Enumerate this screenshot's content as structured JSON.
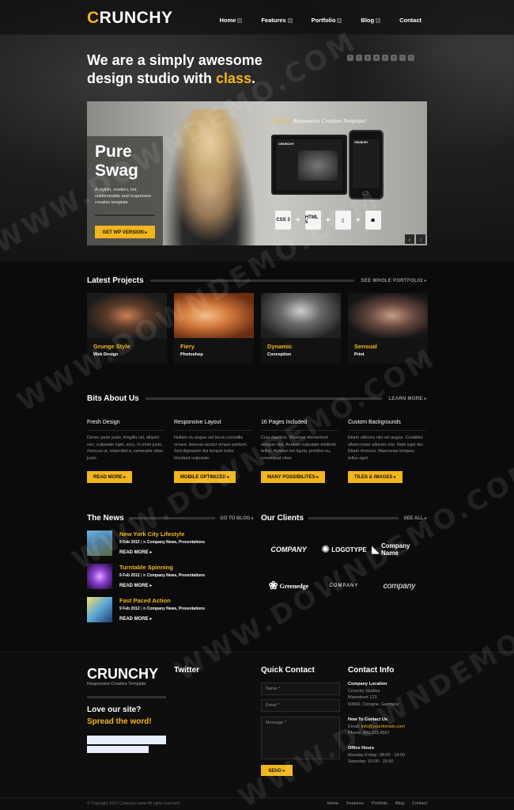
{
  "header": {
    "logo_first": "C",
    "logo_rest": "RUNCHY",
    "nav": [
      "Home",
      "Features",
      "Portfolio",
      "Blog",
      "Contact"
    ]
  },
  "hero": {
    "tagline_part1": "We are a simply awesome design studio with ",
    "tagline_highlight": "class",
    "tagline_end": "."
  },
  "slider": {
    "title_line1": "Pure",
    "title_line2": "Swag",
    "description": "A stylish, modern, hot, customizable and responsive creative template",
    "button": "GET WP VERSION ▸",
    "template_brand": "Crunchy",
    "template_text": " Responsive Creative Template!",
    "laptop_label": "CRUNCHY",
    "phone_label": "CRUNCHY",
    "tech_css": "CSS 3",
    "tech_html": "HTML 5",
    "prev": "‹",
    "next": "›"
  },
  "latest_projects": {
    "title": "Latest Projects",
    "more": "SEE WHOLE PORTFOLIO ▸",
    "items": [
      {
        "name": "Grunge Style",
        "sub": "Web Design"
      },
      {
        "name": "Fiery",
        "sub": "Photoshop"
      },
      {
        "name": "Dynamic",
        "sub": "Conception"
      },
      {
        "name": "Sensual",
        "sub": "Print"
      }
    ]
  },
  "bits": {
    "title": "Bits About Us",
    "more": "LEARN MORE ▸",
    "items": [
      {
        "heading": "Fresh Design",
        "text": "Donec pede justo, fringilla vel, aliquet nec, vulputate eget, arcu. In enim justo, rhoncus ut, imperdiet a, venenatis vitae, justo.",
        "button": "READ MORE ▸"
      },
      {
        "heading": "Responsive Layout",
        "text": "Nullam eu augue vel lacus convallis ornare. Aenean auctor ornare pretium. Sed dignissim dui tempor tortor tincidunt vulputate.",
        "button": "MOBILE OPTIMIZED ▸"
      },
      {
        "heading": "16 Pages Included",
        "text": "Cras dapibus. Vivamus elementum semper nisi. Aenean vulputate eleifend tellus. Aenean leo ligula, porttitor eu, consequat vitae.",
        "button": "MANY POSSIBILITES ▸"
      },
      {
        "heading": "Custom Backgrounds",
        "text": "Etiam ultricies nisi vel augue. Curabitur ullamcorper ultricies nisi. Nam eget dui. Etiam rhoncus. Maecenas tempus, tellus eget.",
        "button": "TILES & IMAGES ▸"
      }
    ]
  },
  "news": {
    "title": "The News",
    "more": "GO TO BLOG ▸",
    "items": [
      {
        "title": "New York City Lifestyle",
        "date": "9 Feb 2012",
        "sep": " | in ",
        "cats": "Company News, Presentations",
        "read": "READ MORE ▸"
      },
      {
        "title": "Turntable Spinning",
        "date": "9 Feb 2012",
        "sep": " | in ",
        "cats": "Company News, Presentations",
        "read": "READ MORE ▸"
      },
      {
        "title": "Fast Paced Action",
        "date": "9 Feb 2012",
        "sep": " | in ",
        "cats": "Company News, Presentations",
        "read": "READ MORE ▸"
      }
    ]
  },
  "clients": {
    "title": "Our Clients",
    "more": "SEE ALL ▸",
    "logos": [
      "COMPANY",
      "LOGOTYPE",
      "Company Name",
      "Greenedge",
      "COMPANY",
      "company"
    ]
  },
  "footer": {
    "logo": "CRUNCHY",
    "sub": "Responsive Creative Template",
    "love": "Love our site?",
    "spread": "Spread the word!",
    "twitter": "Twitter",
    "quick_contact": "Quick Contact",
    "name_placeholder": "Name *",
    "email_placeholder": "Email *",
    "message_placeholder": "Message *",
    "send": "SEND ▸",
    "contact_info": "Contact Info",
    "location_label": "Company Location",
    "location_lines": [
      "Crunchy Studios",
      "Mainstreet 123",
      "50600, Cologne, Germany"
    ],
    "how_label": "How To Contact Us",
    "email_label": "Email: ",
    "email_value": "info@yourdomain.com",
    "phone": "Phone: 800.123.4567",
    "hours_label": "Office Hours",
    "hours_lines": [
      "Monday-Friday: 08:00 - 18:00",
      "Saturday: 10:00 - 15:00"
    ],
    "copyright": "© Copyright 2012 Company name All rights reserved",
    "links": [
      "Home",
      "Features",
      "Portfolio",
      "Blog",
      "Contact"
    ]
  },
  "watermark": "WWW.DOWNDEMO.COM"
}
